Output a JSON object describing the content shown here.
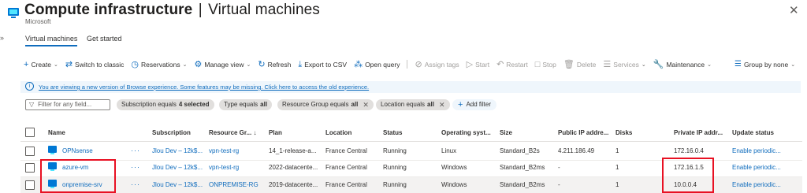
{
  "header": {
    "title_main": "Compute infrastructure",
    "title_sep": "|",
    "title_sub": "Virtual machines",
    "more": "···",
    "publisher": "Microsoft",
    "close": "✕",
    "expand": "»"
  },
  "tabs": [
    {
      "label": "Virtual machines",
      "active": true
    },
    {
      "label": "Get started",
      "active": false
    }
  ],
  "toolbar": {
    "create": "Create",
    "switch_classic": "Switch to classic",
    "reservations": "Reservations",
    "manage_view": "Manage view",
    "refresh": "Refresh",
    "export_csv": "Export to CSV",
    "open_query": "Open query",
    "assign_tags": "Assign tags",
    "start": "Start",
    "restart": "Restart",
    "stop": "Stop",
    "delete": "Delete",
    "services": "Services",
    "maintenance": "Maintenance",
    "group_by": "Group by none"
  },
  "banner": {
    "text": "You are viewing a new version of Browse experience. Some features may be missing. Click here to access the old experience."
  },
  "filters": {
    "search_placeholder": "Filter for any field...",
    "subscription_key": "Subscription equals",
    "subscription_val": "4 selected",
    "type_key": "Type equals",
    "type_val": "all",
    "rg_key": "Resource Group equals",
    "rg_val": "all",
    "location_key": "Location equals",
    "location_val": "all",
    "add_filter": "Add filter"
  },
  "table": {
    "headers": {
      "name": "Name",
      "subscription": "Subscription",
      "resource_group": "Resource Gr... ↓",
      "plan": "Plan",
      "location": "Location",
      "status": "Status",
      "os": "Operating syst...",
      "size": "Size",
      "public_ip": "Public IP addre...",
      "disks": "Disks",
      "private_ip": "Private IP addr...",
      "update_status": "Update status"
    },
    "rows": [
      {
        "name": "OPNsense",
        "dots": "···",
        "subscription": "Jlou Dev – 12k$...",
        "resource_group": "vpn-test-rg",
        "plan": "14_1-release-a...",
        "location": "France Central",
        "status": "Running",
        "os": "Linux",
        "size": "Standard_B2s",
        "public_ip": "4.211.186.49",
        "disks": "1",
        "private_ip": "172.16.0.4",
        "update_status": "Enable periodic..."
      },
      {
        "name": "azure-vm",
        "dots": "···",
        "subscription": "Jlou Dev – 12k$...",
        "resource_group": "vpn-test-rg",
        "plan": "2022-datacente...",
        "location": "France Central",
        "status": "Running",
        "os": "Windows",
        "size": "Standard_B2ms",
        "public_ip": "-",
        "disks": "1",
        "private_ip": "172.16.1.5",
        "update_status": "Enable periodic..."
      },
      {
        "name": "onpremise-srv",
        "dots": "···",
        "subscription": "Jlou Dev – 12k$...",
        "resource_group": "ONPREMISE-RG",
        "plan": "2019-datacente...",
        "location": "France Central",
        "status": "Running",
        "os": "Windows",
        "size": "Standard_B2ms",
        "public_ip": "-",
        "disks": "1",
        "private_ip": "10.0.0.4",
        "update_status": "Enable periodic..."
      }
    ]
  },
  "colors": {
    "accent": "#0f6cbd",
    "highlight_box": "#e81123",
    "banner_bg": "#eff6fc"
  }
}
